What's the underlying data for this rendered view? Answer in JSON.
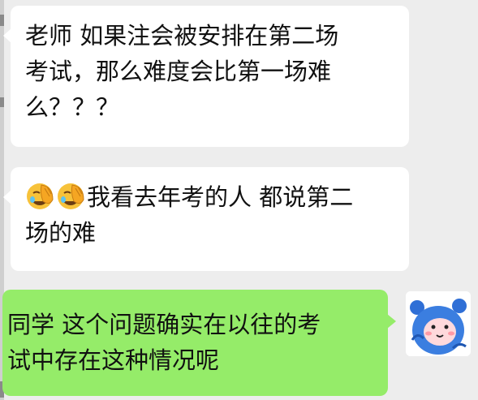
{
  "messages": [
    {
      "direction": "incoming",
      "lines": [
        "老师  如果注会被安排在第二场",
        "考试，那么难度会比第一场难",
        "么？？？"
      ]
    },
    {
      "direction": "incoming",
      "emojis": [
        "facepalm-emoji",
        "facepalm-emoji"
      ],
      "lines": [
        "我看去年考的人 都说第二",
        "场的难"
      ]
    },
    {
      "direction": "outgoing",
      "lines": [
        "同学 这个问题确实在以往的考",
        "试中存在这种情况呢"
      ]
    }
  ],
  "avatar_icon": "blue-bear-avatar",
  "colors": {
    "background": "#ededed",
    "incoming_bubble": "#ffffff",
    "outgoing_bubble": "#95ec69",
    "text": "#111111"
  }
}
